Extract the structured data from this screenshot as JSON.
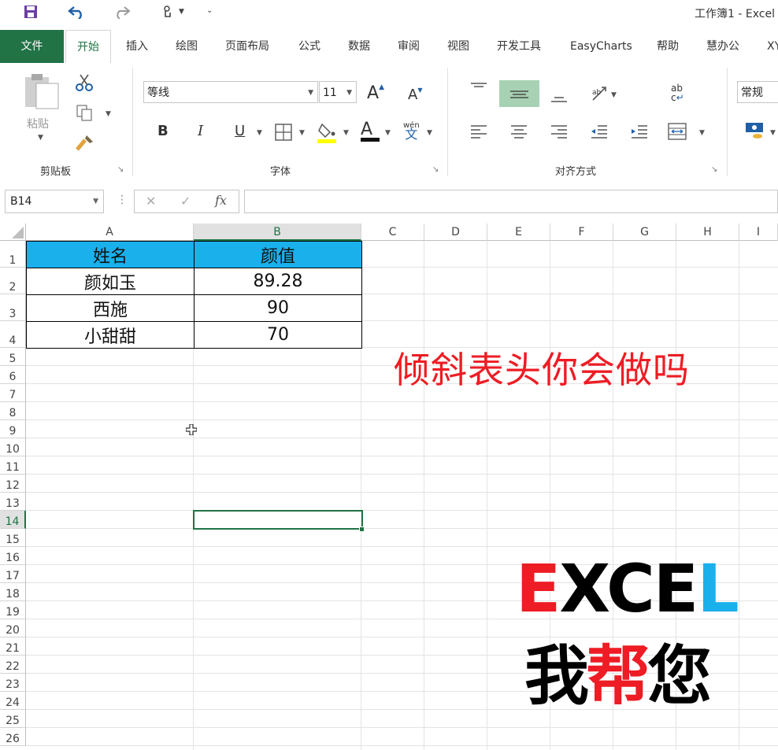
{
  "window": {
    "title": "工作簿1  -  Excel"
  },
  "quick_access": {
    "save_icon": "save-icon",
    "undo_icon": "undo-icon",
    "redo_icon": "redo-icon",
    "touch_icon": "touch-mode-icon"
  },
  "tabs": [
    {
      "label": "文件"
    },
    {
      "label": "开始"
    },
    {
      "label": "插入"
    },
    {
      "label": "绘图"
    },
    {
      "label": "页面布局"
    },
    {
      "label": "公式"
    },
    {
      "label": "数据"
    },
    {
      "label": "审阅"
    },
    {
      "label": "视图"
    },
    {
      "label": "开发工具"
    },
    {
      "label": "EasyCharts"
    },
    {
      "label": "帮助"
    },
    {
      "label": "慧办公"
    },
    {
      "label": "XY"
    }
  ],
  "ribbon": {
    "clipboard": {
      "label": "剪贴板",
      "paste_label": "粘贴"
    },
    "font": {
      "label": "字体",
      "font_name": "等线",
      "font_size": "11",
      "bold": "B",
      "italic": "I",
      "underline": "U",
      "phonetic": "wén"
    },
    "alignment": {
      "label": "对齐方式"
    },
    "number": {
      "format": "常规"
    }
  },
  "formula_bar": {
    "name_box": "B14",
    "cancel": "✕",
    "enter": "✓",
    "fx": "fx",
    "formula": ""
  },
  "sheet": {
    "columns": [
      "A",
      "B",
      "C",
      "D",
      "E",
      "F",
      "G",
      "H",
      "I"
    ],
    "rows": [
      "1",
      "2",
      "3",
      "4",
      "5",
      "6",
      "7",
      "8",
      "9",
      "10",
      "11",
      "12",
      "13",
      "14",
      "15",
      "16",
      "17",
      "18",
      "19",
      "20",
      "21",
      "22",
      "23",
      "24",
      "25",
      "26"
    ],
    "selected_column": "B",
    "selected_row": "14",
    "table": {
      "headers": [
        "姓名",
        "颜值"
      ],
      "rows": [
        [
          "颜如玉",
          "89.28"
        ],
        [
          "西施",
          "90"
        ],
        [
          "小甜甜",
          "70"
        ]
      ]
    },
    "header_fill": "#1ab0ec"
  },
  "overlay": {
    "caption": "倾斜表头你会做吗",
    "logo_line1": {
      "E1": "E",
      "XCE": "XCE",
      "L": "L"
    },
    "logo_line2": {
      "wo": "我",
      "bang": "帮",
      "nin": "您"
    },
    "colors": {
      "red": "#ee1c24",
      "blue": "#1ab0ec",
      "black": "#000000"
    }
  }
}
